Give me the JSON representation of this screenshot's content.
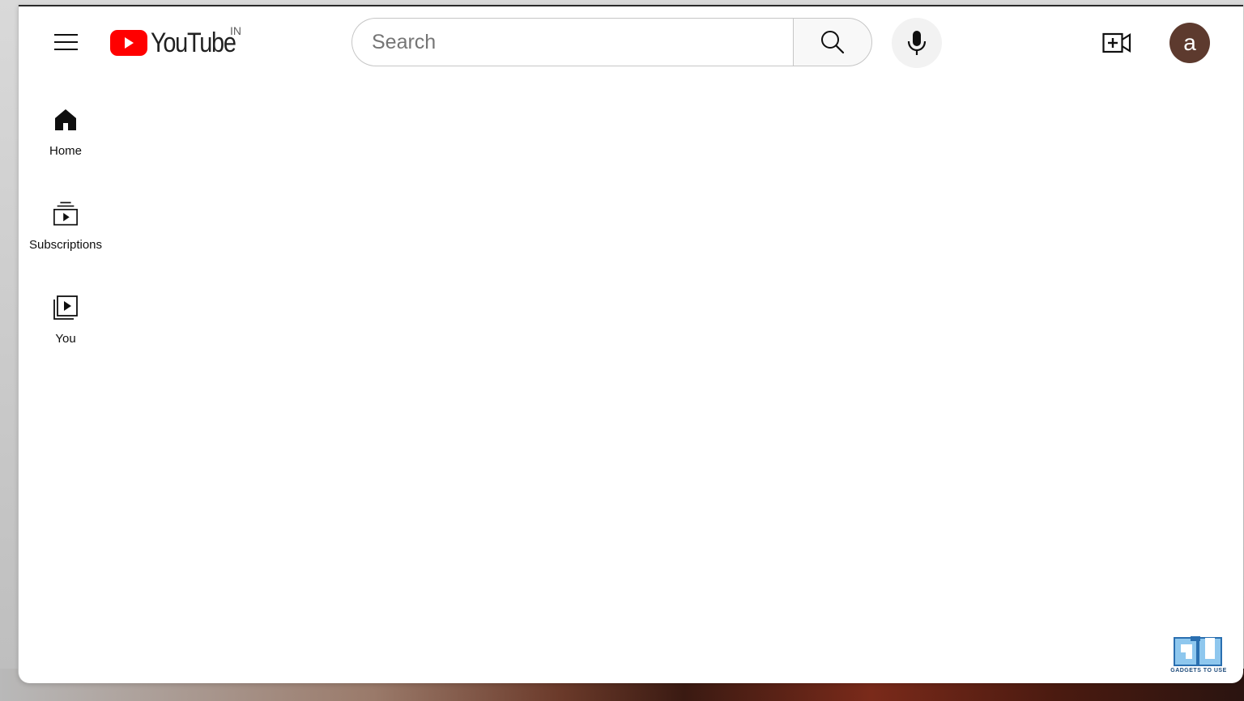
{
  "header": {
    "logo_text": "YouTube",
    "region_code": "IN",
    "search_placeholder": "Search",
    "avatar_letter": "a",
    "icons": {
      "menu": "hamburger-menu-icon",
      "search": "search-icon",
      "mic": "microphone-icon",
      "create": "create-video-icon"
    }
  },
  "sidebar": {
    "items": [
      {
        "label": "Home",
        "icon": "home-icon"
      },
      {
        "label": "Subscriptions",
        "icon": "subscriptions-icon"
      },
      {
        "label": "You",
        "icon": "you-library-icon"
      }
    ]
  },
  "watermark": {
    "logo": "gu-logo",
    "text": "GADGETS TO USE"
  },
  "colors": {
    "brand_red": "#ff0000",
    "avatar_bg": "#5d3a2e",
    "text_primary": "#0f0f0f"
  }
}
